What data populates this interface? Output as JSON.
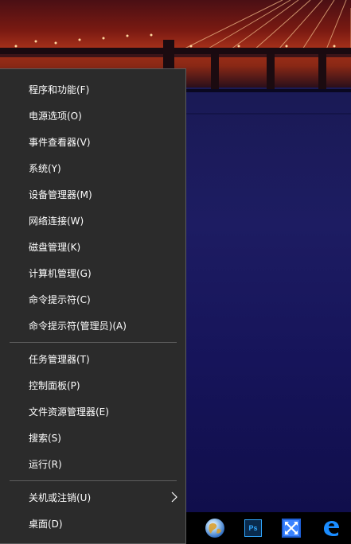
{
  "menu": {
    "items": [
      {
        "label": "程序和功能(F)"
      },
      {
        "label": "电源选项(O)"
      },
      {
        "label": "事件查看器(V)"
      },
      {
        "label": "系统(Y)"
      },
      {
        "label": "设备管理器(M)"
      },
      {
        "label": "网络连接(W)"
      },
      {
        "label": "磁盘管理(K)"
      },
      {
        "label": "计算机管理(G)"
      },
      {
        "label": "命令提示符(C)"
      },
      {
        "label": "命令提示符(管理员)(A)"
      }
    ],
    "items2": [
      {
        "label": "任务管理器(T)"
      },
      {
        "label": "控制面板(P)"
      },
      {
        "label": "文件资源管理器(E)"
      },
      {
        "label": "搜索(S)"
      },
      {
        "label": "运行(R)"
      }
    ],
    "items3": [
      {
        "label": "关机或注销(U)",
        "submenu": true
      },
      {
        "label": "桌面(D)"
      }
    ]
  },
  "taskbar": {
    "icons": [
      "globe-icon",
      "photoshop-icon",
      "remote-desktop-icon",
      "edge-icon"
    ],
    "photoshop_text": "Ps"
  },
  "colors": {
    "menu_bg": "#2b2b2b",
    "menu_text": "#ffffff",
    "separator": "#5e5e5e",
    "taskbar_bg": "#000000"
  }
}
